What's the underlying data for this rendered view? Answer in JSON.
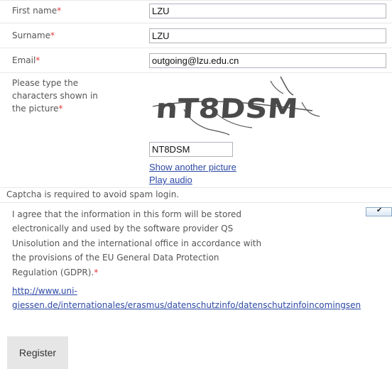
{
  "form": {
    "first_name": {
      "label": "First name",
      "required_mark": "*",
      "value": "LZU"
    },
    "surname": {
      "label": "Surname",
      "required_mark": "*",
      "value": "LZU"
    },
    "email": {
      "label": "Email",
      "required_mark": "*",
      "value": "outgoing@lzu.edu.cn"
    },
    "captcha": {
      "label_lines": [
        "Please type the",
        "characters shown in",
        "the picture"
      ],
      "required_mark": "*",
      "image_text": "nT8DSM",
      "value": "NT8DSM",
      "show_another_label": "Show another picture",
      "play_audio_label": "Play audio",
      "note": "Captcha is required to avoid spam login."
    },
    "gdpr": {
      "lines": [
        "I agree that the information in this form will be stored",
        "electronically and used by the software provider QS",
        "Unisolution and the international office in accordance with",
        "the provisions of the EU General Data Protection",
        "Regulation (GDPR)."
      ],
      "required_mark": "*",
      "link_lines": [
        "http://www.uni-",
        "giessen.de/internationales/erasmus/datenschutzinfo/datenschutzinfoincomingsen"
      ],
      "checked": true
    },
    "register_label": "Register"
  }
}
